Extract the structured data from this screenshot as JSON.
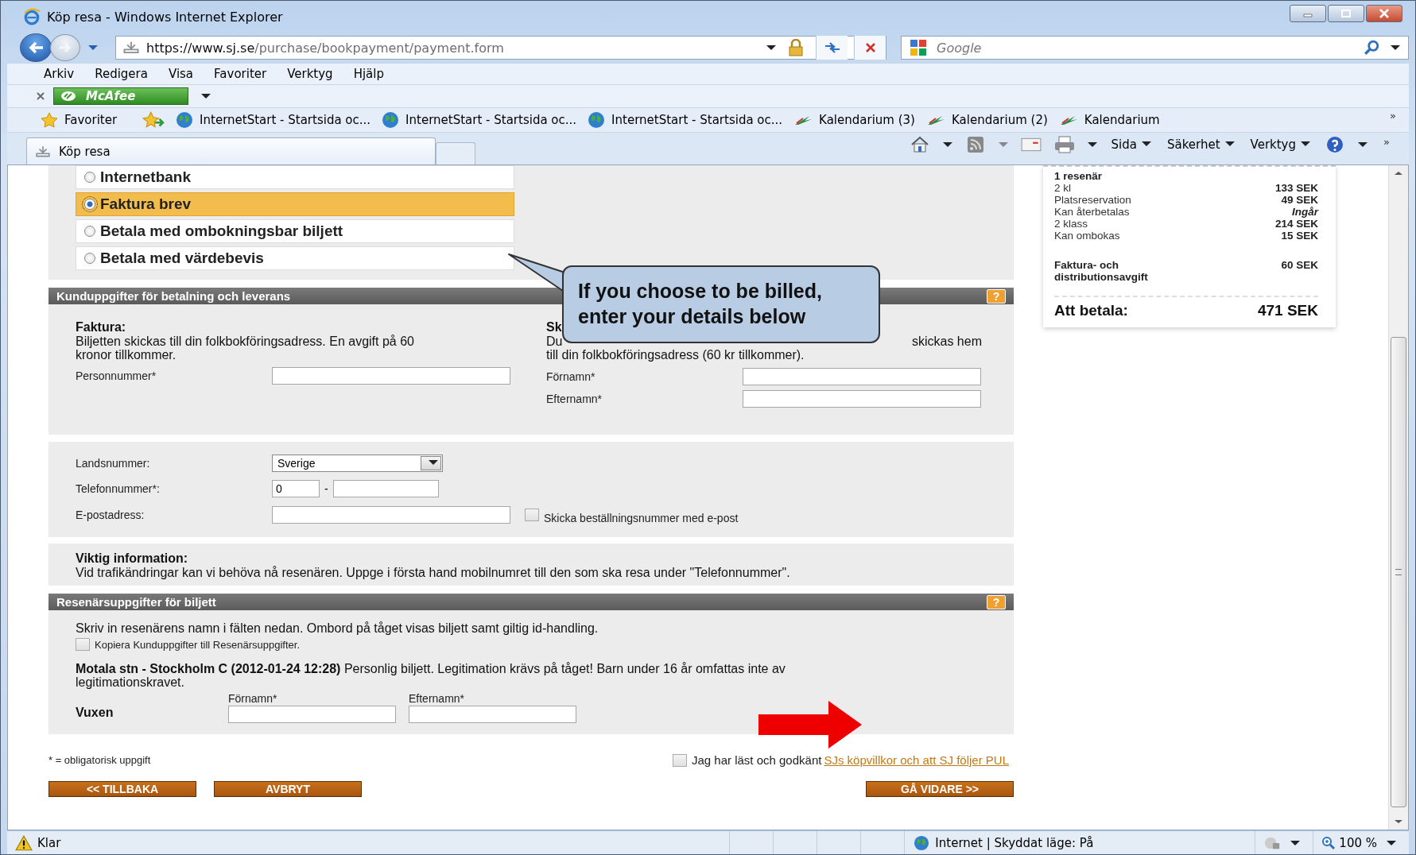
{
  "window": {
    "title": "Köp resa - Windows Internet Explorer"
  },
  "address_bar": {
    "url_host": "https://www.sj.se",
    "url_path": "/purchase/bookpayment/payment.form"
  },
  "search": {
    "placeholder": "Google"
  },
  "menu": [
    "Arkiv",
    "Redigera",
    "Visa",
    "Favoriter",
    "Verktyg",
    "Hjälp"
  ],
  "addon_toolbar": {
    "label": "McAfee"
  },
  "favorites_bar": {
    "label": "Favoriter",
    "overflow": "»",
    "items": [
      {
        "label": "InternetStart - Startsida oc...",
        "kind": "globe"
      },
      {
        "label": "InternetStart - Startsida oc...",
        "kind": "globe"
      },
      {
        "label": "InternetStart - Startsida oc...",
        "kind": "globe"
      },
      {
        "label": "Kalendarium (3)",
        "kind": "calendar"
      },
      {
        "label": "Kalendarium (2)",
        "kind": "calendar"
      },
      {
        "label": "Kalendarium",
        "kind": "calendar"
      }
    ]
  },
  "tabs": [
    {
      "label": "Köp resa",
      "selected": true
    }
  ],
  "command_bar": {
    "menus": [
      "Sida",
      "Säkerhet",
      "Verktyg"
    ],
    "overflow": "»"
  },
  "payment_options": [
    {
      "label": "Internetbank",
      "selected": false
    },
    {
      "label": "Faktura brev",
      "selected": true
    },
    {
      "label": "Betala med ombokningsbar biljett",
      "selected": false
    },
    {
      "label": "Betala med värdebevis",
      "selected": false
    }
  ],
  "customer_section": {
    "title": "Kunduppgifter för betalning och leverans",
    "help": "?",
    "invoice": {
      "heading": "Faktura:",
      "text": "Biljetten skickas till din folkbokföringsadress. En avgift på 60 kronor tillkommer.",
      "fields": [
        {
          "label": "Personnummer*"
        }
      ]
    },
    "right_column": {
      "heading": "Sk",
      "text_start": "Du",
      "text_end": "skickas hem",
      "text_line2": "till din folkbokföringsadress (60 kr tillkommer).",
      "fields": [
        {
          "label": "Förnamn*"
        },
        {
          "label": "Efternamn*"
        }
      ]
    }
  },
  "contact": {
    "country_label": "Landsnummer:",
    "country": "Sverige",
    "phone_label": "Telefonnummer*:",
    "phone_prefix": "0",
    "phone_separator": "-",
    "email_label": "E-postadress:",
    "email_option": {
      "label": "Skicka beställningsnummer med e-post",
      "checked": false
    }
  },
  "important": {
    "heading": "Viktig information:",
    "text": "Vid trafikändringar kan vi behöva nå resenären. Uppge i första hand mobilnumret till den som ska resa under \"Telefonnummer\"."
  },
  "traveler_section": {
    "title": "Resenärsuppgifter för biljett",
    "help": "?",
    "intro": "Skriv in resenärens namn i fälten nedan. Ombord på tåget visas biljett samt giltig id-handling.",
    "copy_option": {
      "label": "Kopiera Kunduppgifter till Resenärsuppgifter.",
      "checked": false
    },
    "trip": "**Motala stn - Stockholm C (2012-01-24 12:28)** Personlig biljett. Legitimation krävs på tåget! Barn under 16 år omfattas inte av legitimationskravet.",
    "travelers": [
      {
        "type": "Vuxen",
        "first_name_label": "Förnamn*",
        "last_name_label": "Efternamn*"
      }
    ]
  },
  "footer": {
    "required_note": "* = obligatorisk uppgift",
    "terms": {
      "label": "Jag har läst och godkänt",
      "link": "SJs köpvillkor och att SJ följer PUL",
      "checked": false
    },
    "back_button": "<< TILLBAKA",
    "cancel_button": "AVBRYT",
    "next_button": "GÅ VIDARE >>"
  },
  "summary": {
    "travelers": "1 resenär",
    "lines": [
      {
        "label": "2 kl",
        "amount": "133 SEK",
        "kind": "price"
      },
      {
        "label": "Platsreservation",
        "amount": "49 SEK",
        "kind": "price"
      },
      {
        "label": "Kan återbetalas",
        "amount": "Ingår",
        "kind": "included"
      },
      {
        "label": "2 klass",
        "amount": "214 SEK",
        "kind": "price"
      },
      {
        "label": "Kan ombokas",
        "amount": "15 SEK",
        "kind": "price"
      }
    ],
    "fee": {
      "label": "Faktura- och distributionsavgift",
      "amount": "60 SEK"
    },
    "total": {
      "label": "Att betala:",
      "amount": "471 SEK"
    }
  },
  "callout": {
    "text": "If you choose to be billed, enter your details below"
  },
  "status_bar": {
    "status": "Klar",
    "zone": "Internet | Skyddat läge: På",
    "zoom": "100 %"
  }
}
